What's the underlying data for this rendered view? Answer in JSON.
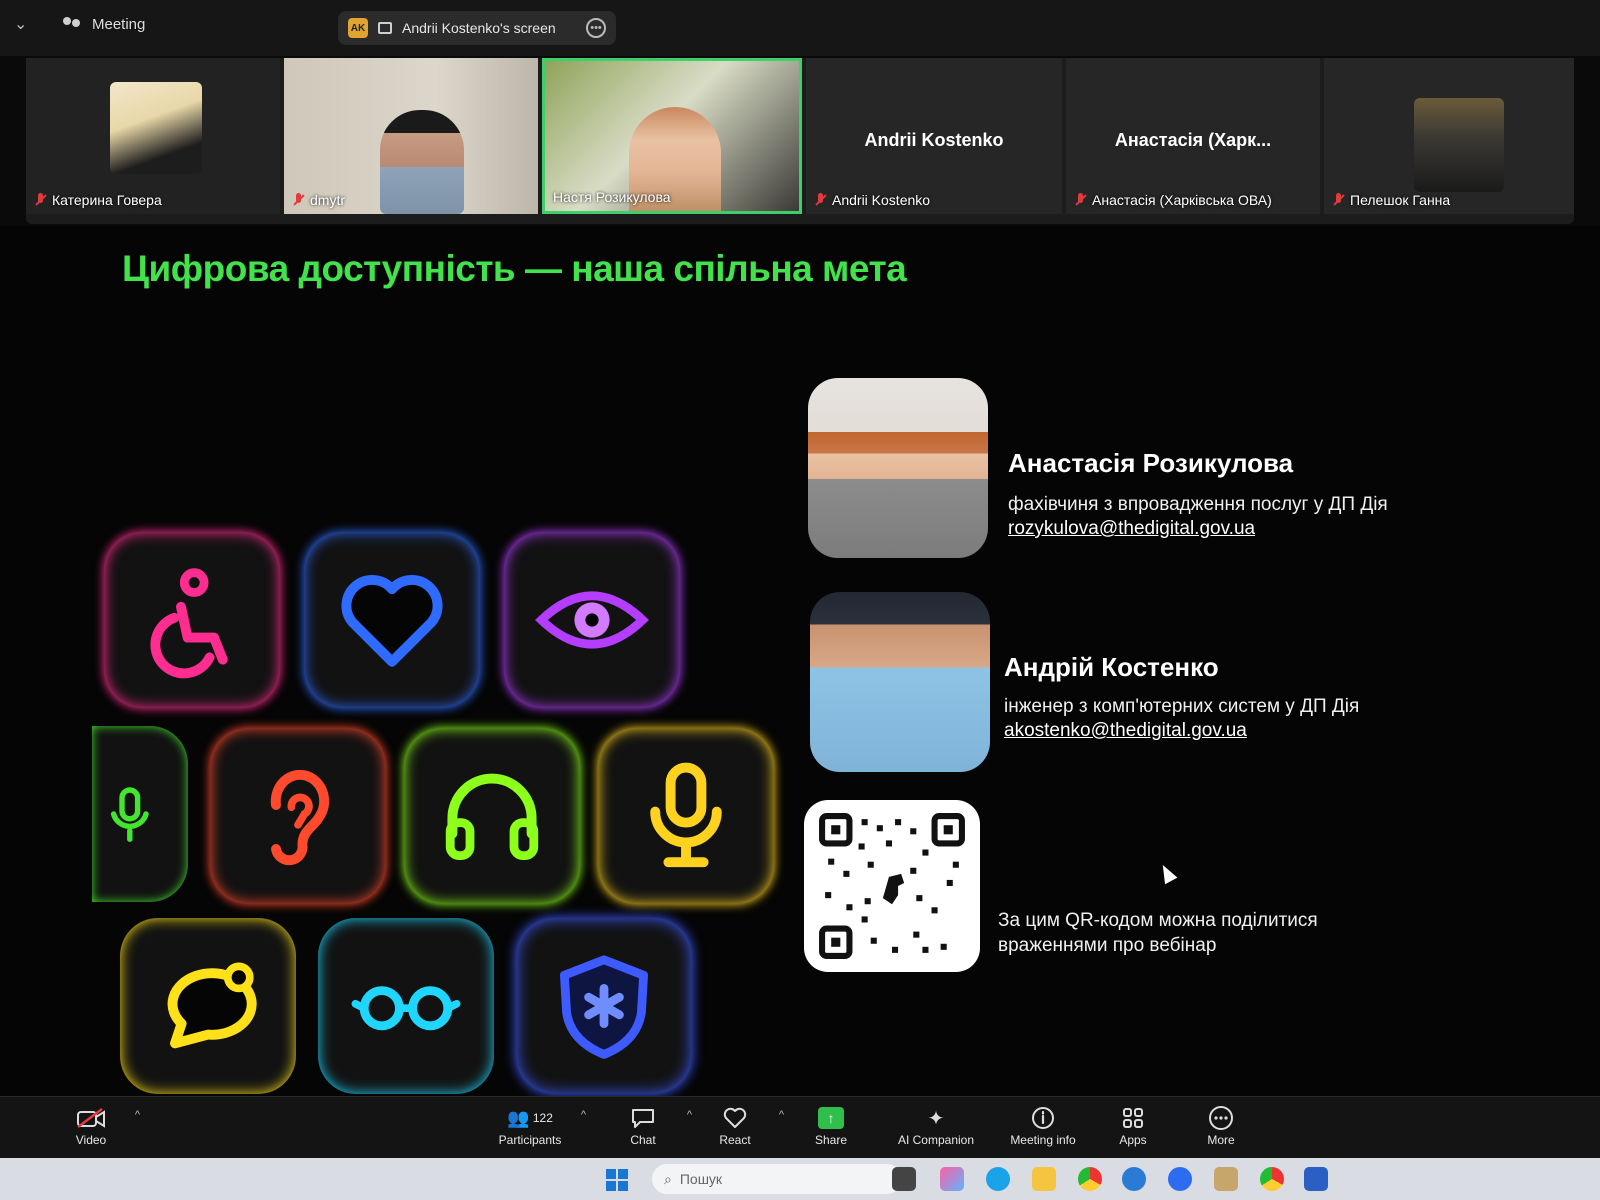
{
  "topbar": {
    "meeting_label": "Meeting",
    "share_badge": "AK",
    "share_label": "Andrii Kostenko's screen"
  },
  "participants": [
    {
      "name": "Катерина Говера",
      "muted": true,
      "video": true
    },
    {
      "name": "dmytr",
      "muted": true,
      "video": true
    },
    {
      "name": "Настя Розикулова",
      "muted": false,
      "video": true,
      "active_speaker": true
    },
    {
      "name": "Andrii Kostenko",
      "display_name": "Andrii Kostenko",
      "muted": true,
      "video": false
    },
    {
      "name": "Анастасія (Харківська ОВА)",
      "display_name": "Анастасія (Харк...",
      "muted": true,
      "video": false
    },
    {
      "name": "Пелешок Ганна",
      "muted": true,
      "video": true
    }
  ],
  "slide": {
    "title": "Цифрова доступність — наша спільна мета",
    "icons": [
      {
        "name": "wheelchair-icon",
        "color": "#ff2d8f"
      },
      {
        "name": "heart-icon",
        "color": "#2f6bff"
      },
      {
        "name": "eye-icon",
        "color": "#b43dff"
      },
      {
        "name": "microphone-icon",
        "color": "#43e62e"
      },
      {
        "name": "ear-icon",
        "color": "#ff4a2e"
      },
      {
        "name": "headphones-icon",
        "color": "#8cff1a"
      },
      {
        "name": "microphone-icon",
        "color": "#ffd21f"
      },
      {
        "name": "speech-bubble-icon",
        "color": "#ffe11a"
      },
      {
        "name": "glasses-icon",
        "color": "#1fd6ff"
      },
      {
        "name": "shield-asterisk-icon",
        "color": "#3d5bff"
      }
    ],
    "people": [
      {
        "name": "Анастасія Розикулова",
        "role": "фахівчиня з впровадження послуг у ДП Дія",
        "email": "rozykulova@thedigital.gov.ua"
      },
      {
        "name": "Андрій Костенко",
        "role": "інженер з комп'ютерних систем у ДП Дія",
        "email": "akostenko@thedigital.gov.ua"
      }
    ],
    "qr_text": "За цим QR-кодом можна поділитися враженнями про вебінар"
  },
  "toolbar": {
    "video": "Video",
    "participants_count": "122",
    "participants": "Participants",
    "chat": "Chat",
    "react": "React",
    "share": "Share",
    "ai_companion": "AI Companion",
    "meeting_info": "Meeting info",
    "apps": "Apps",
    "more": "More"
  },
  "taskbar": {
    "search_placeholder": "Пошук"
  },
  "colors": {
    "title_green": "#41e24b",
    "active_border": "#3ecf6a",
    "share_green": "#2fbf4a",
    "mute_red": "#e23b3b"
  }
}
